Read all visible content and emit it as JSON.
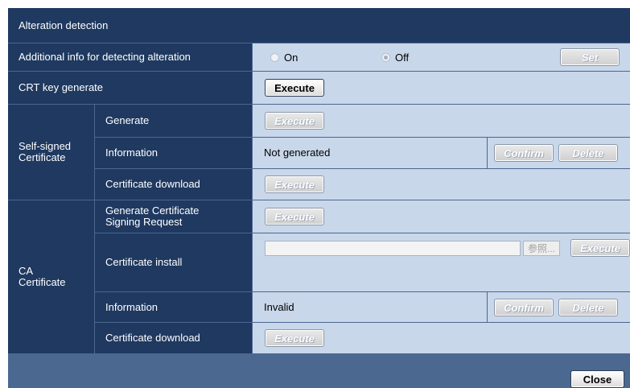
{
  "title": "Alteration detection",
  "rows": {
    "additional_info": {
      "label": "Additional info for detecting alteration",
      "on_label": "On",
      "off_label": "Off",
      "selected": "Off",
      "set_button": "Set"
    },
    "crt_key": {
      "label": "CRT key generate",
      "execute_button": "Execute"
    }
  },
  "self_signed": {
    "group_label": "Self-signed\nCertificate",
    "generate": {
      "label": "Generate",
      "execute_button": "Execute"
    },
    "information": {
      "label": "Information",
      "value": "Not generated",
      "confirm_button": "Confirm",
      "delete_button": "Delete"
    },
    "download": {
      "label": "Certificate download",
      "execute_button": "Execute"
    }
  },
  "ca": {
    "group_label": "CA\nCertificate",
    "csr": {
      "label": "Generate Certificate\nSigning Request",
      "execute_button": "Execute"
    },
    "install": {
      "label": "Certificate install",
      "file_value": "",
      "browse_button": "参照...",
      "execute_button": "Execute"
    },
    "information": {
      "label": "Information",
      "value": "Invalid",
      "confirm_button": "Confirm",
      "delete_button": "Delete"
    },
    "download": {
      "label": "Certificate download",
      "execute_button": "Execute"
    }
  },
  "footer": {
    "close_button": "Close"
  },
  "colors": {
    "header_bg": "#1f3960",
    "cell_bg": "#c8d7ea",
    "frame_bg": "#4b6891"
  }
}
